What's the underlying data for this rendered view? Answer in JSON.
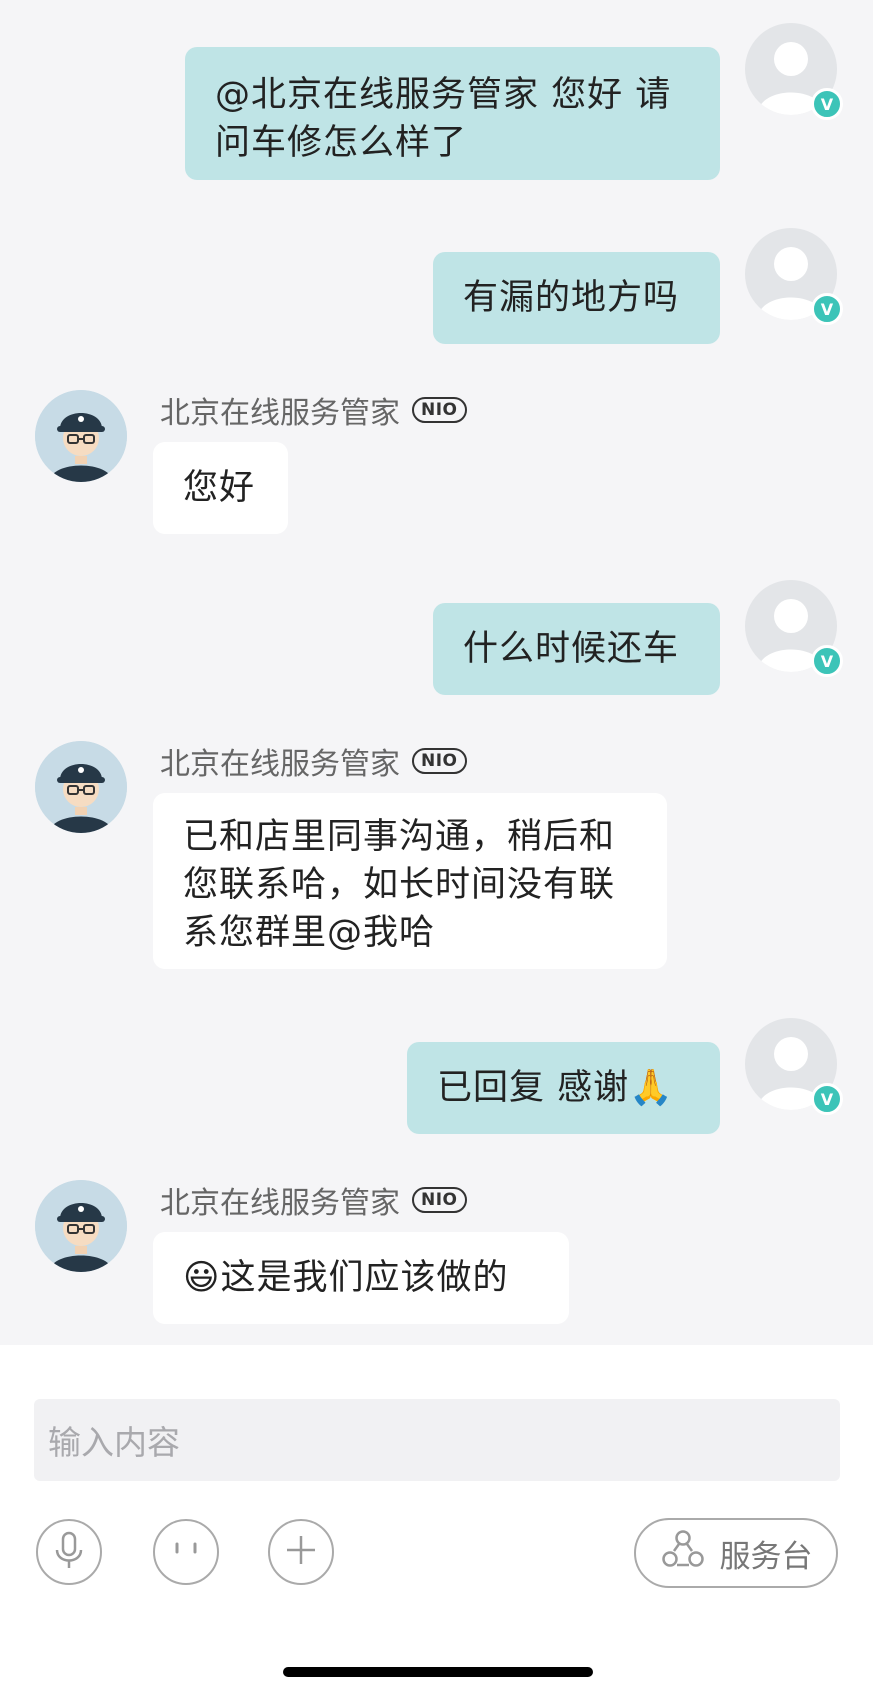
{
  "messages": [
    {
      "from": "user",
      "text": "@北京在线服务管家 您好 请\n问车修怎么样了"
    },
    {
      "from": "user",
      "text": "有漏的地方吗"
    },
    {
      "from": "agent",
      "sender": "北京在线服务管家",
      "text": "您好"
    },
    {
      "from": "user",
      "text": "什么时候还车"
    },
    {
      "from": "agent",
      "sender": "北京在线服务管家",
      "text": "已和店里同事沟通，稍后和\n您联系哈，如长时间没有联\n系您群里@我哈"
    },
    {
      "from": "user",
      "text": "已回复 感谢🙏"
    },
    {
      "from": "agent",
      "sender": "北京在线服务管家",
      "text": "😃这是我们应该做的"
    }
  ],
  "nio_badge": "NIO",
  "verified_badge": "V",
  "input": {
    "placeholder": "输入内容"
  },
  "toolbar": {
    "service_label": "服务台",
    "icons": [
      "microphone-icon",
      "emoji-icon",
      "plus-icon",
      "service-desk-icon"
    ]
  },
  "colors": {
    "user_bubble": "#bfe4e6",
    "agent_bubble": "#ffffff",
    "chat_background": "#f5f5f7",
    "verified_badge": "#3cc4b8"
  }
}
